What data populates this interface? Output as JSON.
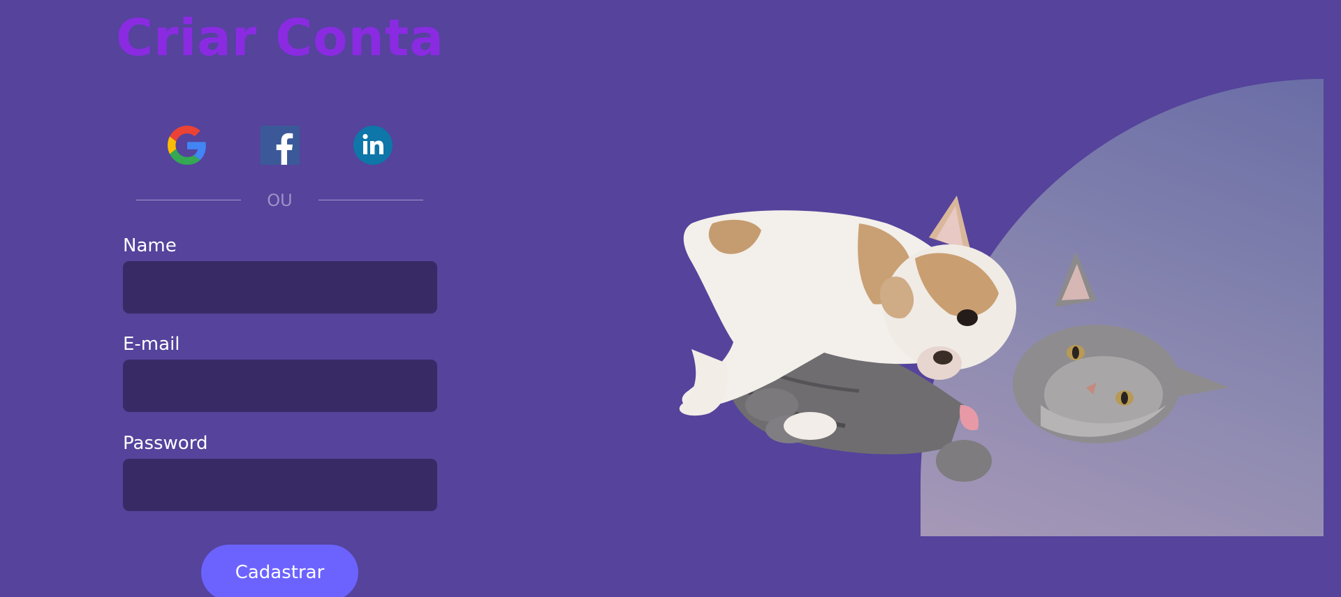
{
  "title": "Criar Conta",
  "social": {
    "google_icon": "google-icon",
    "facebook_icon": "facebook-icon",
    "linkedin_icon": "linkedin-icon"
  },
  "divider_text": "OU",
  "form": {
    "name_label": "Name",
    "name_value": "",
    "email_label": "E-mail",
    "email_value": "",
    "password_label": "Password",
    "password_value": "",
    "submit_label": "Cadastrar"
  },
  "colors": {
    "background": "#55439c",
    "title": "#8a2be2",
    "input": "#382a65",
    "button": "#6c63ff"
  }
}
